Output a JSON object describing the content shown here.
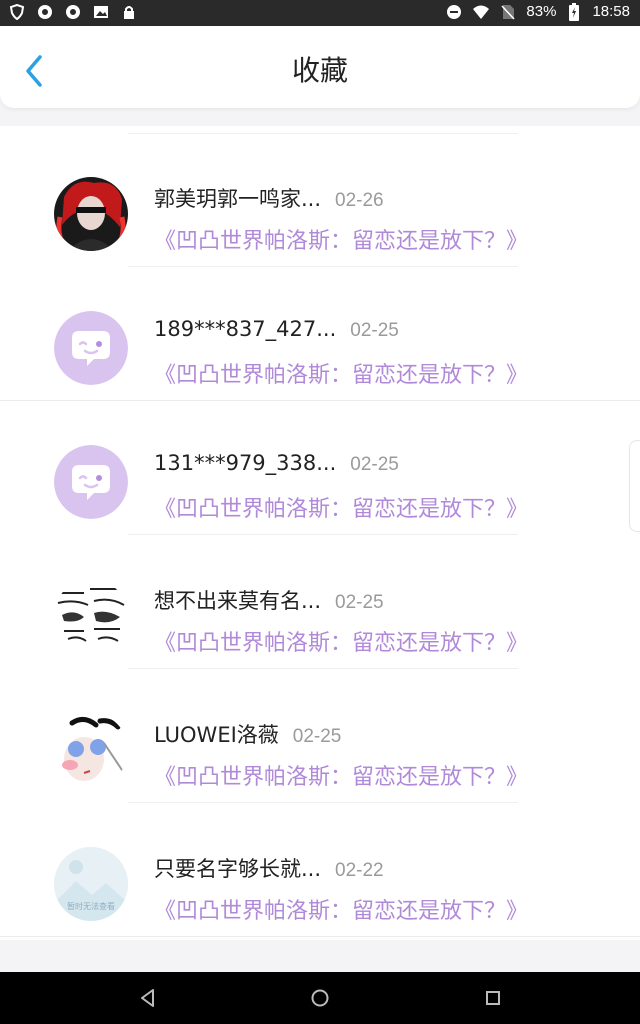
{
  "status_bar": {
    "battery": "83%",
    "time": "18:58"
  },
  "header": {
    "title": "收藏"
  },
  "items": [
    {
      "name": "郭美玥郭一鸣家...",
      "date": "02-26",
      "article": "《凹凸世界帕洛斯：留恋还是放下？》",
      "avatar": "red-character-avatar"
    },
    {
      "name": "189***837_427...",
      "date": "02-25",
      "article": "《凹凸世界帕洛斯：留恋还是放下？》",
      "avatar": "default-chat-avatar"
    },
    {
      "name": "131***979_338...",
      "date": "02-25",
      "article": "《凹凸世界帕洛斯：留恋还是放下？》",
      "avatar": "default-chat-avatar"
    },
    {
      "name": "想不出来莫有名...",
      "date": "02-25",
      "article": "《凹凸世界帕洛斯：留恋还是放下？》",
      "avatar": "sketch-avatar"
    },
    {
      "name": "LUOWEI洛薇",
      "date": "02-25",
      "article": "《凹凸世界帕洛斯：留恋还是放下？》",
      "avatar": "anime-avatar"
    },
    {
      "name": "只要名字够长就...",
      "date": "02-22",
      "article": "《凹凸世界帕洛斯：留恋还是放下？》",
      "avatar": "placeholder-image-avatar",
      "avatar_text": "暂时无法查看"
    }
  ],
  "colors": {
    "accent_blue": "#2aa0e6",
    "article_purple": "#b08ad8",
    "avatar_purple": "#d9c4f0"
  }
}
